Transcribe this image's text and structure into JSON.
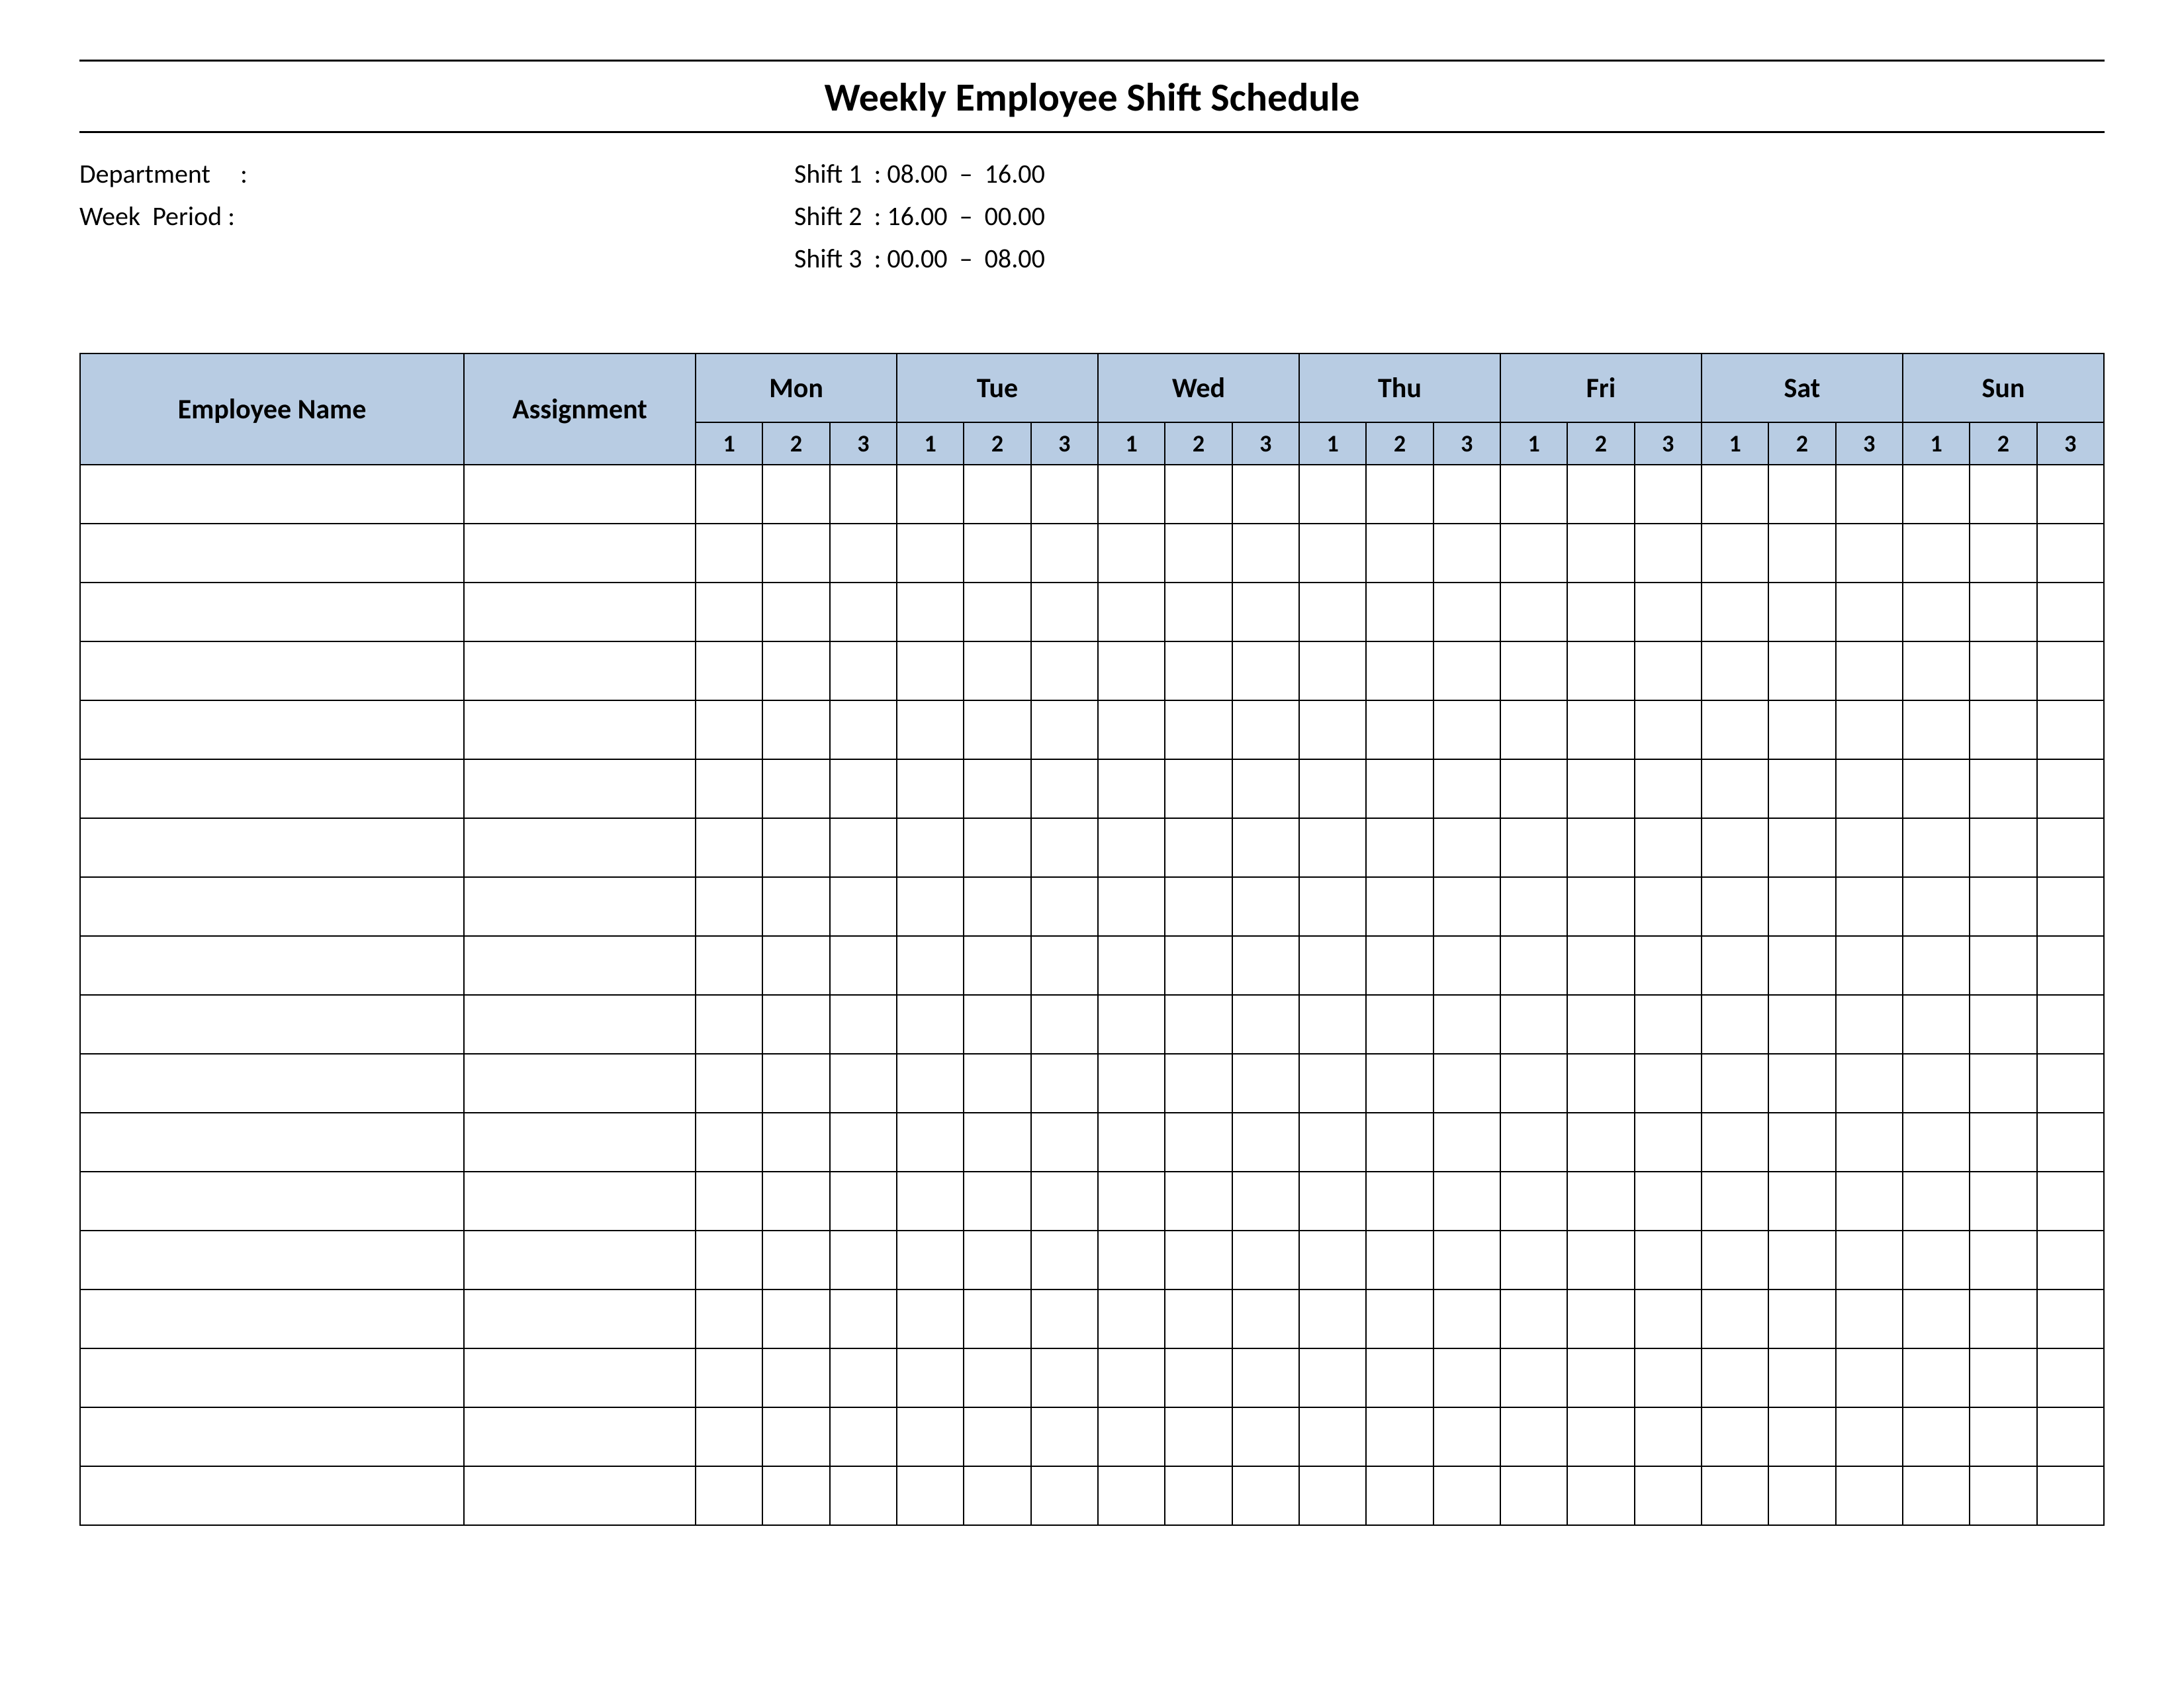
{
  "title": "Weekly Employee Shift Schedule",
  "meta": {
    "department_label": "Department",
    "department_value": "",
    "week_period_label": "Week  Period",
    "week_period_value": ""
  },
  "shifts": [
    {
      "label": "Shift 1",
      "range": "08.00  –  16.00"
    },
    {
      "label": "Shift 2",
      "range": "16.00  –  00.00"
    },
    {
      "label": "Shift 3",
      "range": "00.00  –  08.00"
    }
  ],
  "columns": {
    "employee_name": "Employee Name",
    "assignment": "Assignment",
    "days": [
      "Mon",
      "Tue",
      "Wed",
      "Thu",
      "Fri",
      "Sat",
      "Sun"
    ],
    "sub_shifts": [
      "1",
      "2",
      "3"
    ]
  },
  "row_count": 18
}
